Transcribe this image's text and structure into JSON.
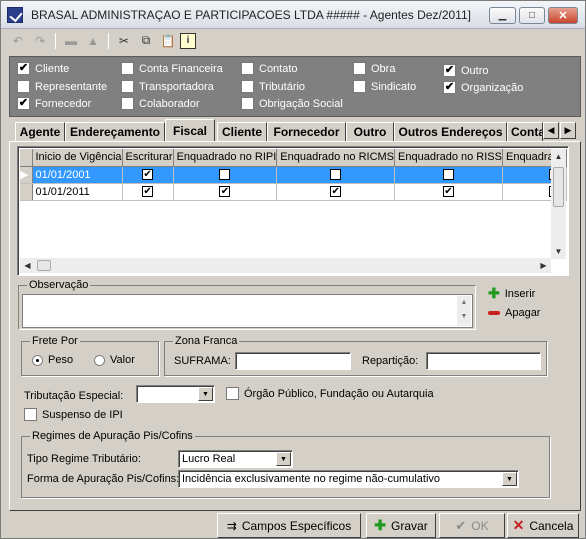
{
  "window": {
    "title": "BRASAL ADMINISTRAÇAO E PARTICIPACOES LTDA #####  -  Agentes Dez/2011]"
  },
  "types": [
    {
      "label": "Cliente",
      "checked": true
    },
    {
      "label": "Representante",
      "checked": false
    },
    {
      "label": "Fornecedor",
      "checked": true
    },
    {
      "label": "Conta Financeira",
      "checked": false
    },
    {
      "label": "Transportadora",
      "checked": false
    },
    {
      "label": "Colaborador",
      "checked": false
    },
    {
      "label": "Contato",
      "checked": false
    },
    {
      "label": "Tributário",
      "checked": false
    },
    {
      "label": "Obrigação Social",
      "checked": false
    },
    {
      "label": "Obra",
      "checked": false
    },
    {
      "label": "Sindicato",
      "checked": false
    },
    {
      "label": "Outro",
      "checked": true
    },
    {
      "label": "Organização",
      "checked": true
    }
  ],
  "tabs": [
    "Agente",
    "Endereçamento",
    "Fiscal",
    "Cliente",
    "Fornecedor",
    "Outro",
    "Outros Endereços",
    "Conta"
  ],
  "active_tab": "Fiscal",
  "grid": {
    "columns": [
      "Inicio de Vigência",
      "Escriturar",
      "Enquadrado no RIPI",
      "Enquadrado no RICMS",
      "Enquadrado no RISS",
      "Enquadrado"
    ],
    "rows": [
      {
        "date": "01/01/2001",
        "checks": [
          true,
          false,
          false,
          false,
          true
        ]
      },
      {
        "date": "01/01/2011",
        "checks": [
          true,
          true,
          true,
          true,
          true
        ]
      }
    ]
  },
  "obs": {
    "label": "Observação"
  },
  "side": {
    "inserir": "Inserir",
    "apagar": "Apagar"
  },
  "frete": {
    "label": "Frete Por",
    "peso": "Peso",
    "valor": "Valor",
    "selected": "Peso"
  },
  "zona": {
    "label": "Zona Franca",
    "suframa": "SUFRAMA:",
    "reparticao": "Repartição:"
  },
  "trib": {
    "label": "Tributação Especial:",
    "value": "",
    "orgao": "Órgão Público, Fundação ou Autarquia",
    "suspenso": "Suspenso de IPI"
  },
  "regimes": {
    "label": "Regimes de Apuração Pis/Cofins",
    "tipo_label": "Tipo Regime Tributário:",
    "tipo_value": "Lucro Real",
    "forma_label": "Forma de Apuração Pis/Cofins:",
    "forma_value": "Incidência exclusivamente no regime não-cumulativo"
  },
  "buttons": {
    "campos": "Campos Específicos",
    "gravar": "Gravar",
    "ok": "OK",
    "cancela": "Cancela"
  }
}
